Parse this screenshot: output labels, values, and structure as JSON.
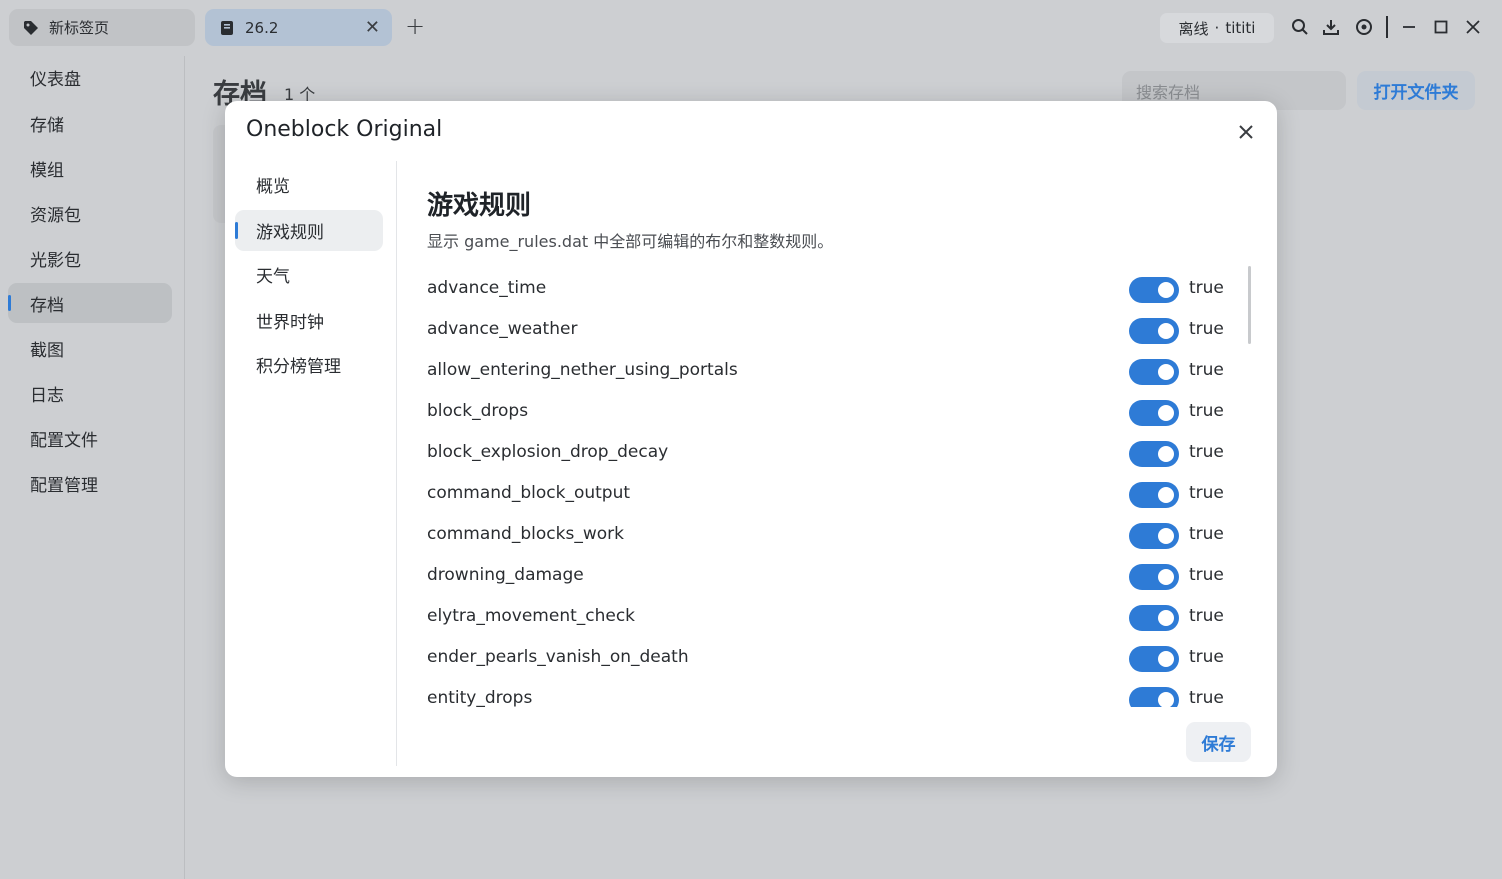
{
  "titlebar": {
    "tabs": [
      {
        "label": "新标签页",
        "icon": "tag-icon"
      },
      {
        "label": "26.2",
        "icon": "book-icon"
      }
    ],
    "account": {
      "status": "离线",
      "separator": "·",
      "user": "tititi"
    }
  },
  "sidebar": {
    "items": [
      {
        "label": "仪表盘"
      },
      {
        "label": "存储"
      },
      {
        "label": "模组"
      },
      {
        "label": "资源包"
      },
      {
        "label": "光影包"
      },
      {
        "label": "存档"
      },
      {
        "label": "截图"
      },
      {
        "label": "日志"
      },
      {
        "label": "配置文件"
      },
      {
        "label": "配置管理"
      }
    ],
    "active": "存档"
  },
  "main": {
    "title": "存档",
    "count": "1 个",
    "search_placeholder": "搜索存档",
    "open_folder_label": "打开文件夹"
  },
  "modal": {
    "title": "Oneblock Original",
    "nav": [
      {
        "label": "概览"
      },
      {
        "label": "游戏规则"
      },
      {
        "label": "天气"
      },
      {
        "label": "世界时钟"
      },
      {
        "label": "积分榜管理"
      }
    ],
    "active_nav": "游戏规则",
    "content_title": "游戏规则",
    "content_desc": "显示 game_rules.dat 中全部可编辑的布尔和整数规则。",
    "rules": [
      {
        "name": "advance_time",
        "value": "true"
      },
      {
        "name": "advance_weather",
        "value": "true"
      },
      {
        "name": "allow_entering_nether_using_portals",
        "value": "true"
      },
      {
        "name": "block_drops",
        "value": "true"
      },
      {
        "name": "block_explosion_drop_decay",
        "value": "true"
      },
      {
        "name": "command_block_output",
        "value": "true"
      },
      {
        "name": "command_blocks_work",
        "value": "true"
      },
      {
        "name": "drowning_damage",
        "value": "true"
      },
      {
        "name": "elytra_movement_check",
        "value": "true"
      },
      {
        "name": "ender_pearls_vanish_on_death",
        "value": "true"
      },
      {
        "name": "entity_drops",
        "value": "true"
      }
    ],
    "save_label": "保存"
  },
  "colors": {
    "accent": "#2e7bd6",
    "background": "#cdcfd2",
    "modal": "#ffffff"
  }
}
